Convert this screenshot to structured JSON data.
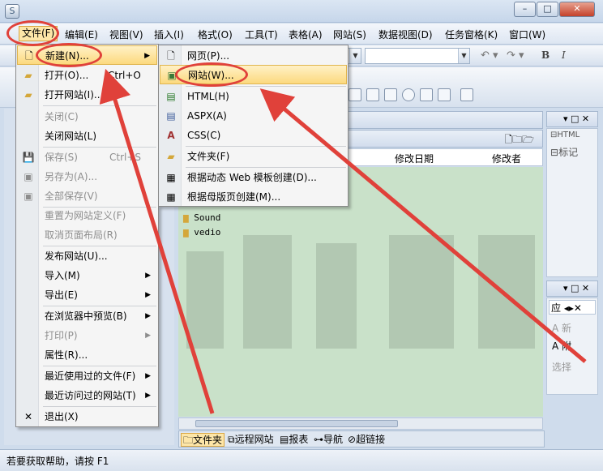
{
  "menubar": {
    "file": "文件(F)",
    "edit": "编辑(E)",
    "view": "视图(V)",
    "insert": "插入(I)",
    "format": "格式(O)",
    "tools": "工具(T)",
    "table": "表格(A)",
    "site": "网站(S)",
    "dataview": "数据视图(D)",
    "taskpane": "任务窗格(K)",
    "window": "窗口(W)"
  },
  "file_menu": {
    "new": "新建(N)...",
    "open": "打开(O)...",
    "open_shortcut": "Ctrl+O",
    "open_site": "打开网站(I)...",
    "close": "关闭(C)",
    "close_site": "关闭网站(L)",
    "save": "保存(S)",
    "save_shortcut": "Ctrl+S",
    "save_as": "另存为(A)...",
    "save_all": "全部保存(V)",
    "reset_site": "重置为网站定义(F)",
    "cancel_layout": "取消页面布局(R)",
    "publish": "发布网站(U)...",
    "import": "导入(M)",
    "export": "导出(E)",
    "preview": "在浏览器中预览(B)",
    "print": "打印(P)",
    "properties": "属性(R)...",
    "recent_files": "最近使用过的文件(F)",
    "recent_sites": "最近访问过的网站(T)",
    "exit": "退出(X)"
  },
  "new_submenu": {
    "page": "网页(P)...",
    "site": "网站(W)...",
    "html": "HTML(H)",
    "aspx": "ASPX(A)",
    "css": "CSS(C)",
    "folder": "文件夹(F)",
    "from_dynamic_template": "根据动态 Web 模板创建(D)...",
    "from_master_page": "根据母版页创建(M)..."
  },
  "filelist": {
    "col_modified": "修改日期",
    "col_modifier": "修改者",
    "rows": [
      "Sound",
      "vedio"
    ]
  },
  "right_panel": {
    "items": [
      "HTML",
      "标记",
      "应",
      "新",
      "附",
      "选择"
    ]
  },
  "bottom_tabs": {
    "folders": "文件夹",
    "remote": "远程网站",
    "reports": "报表",
    "navigation": "导航",
    "hyperlinks": "超链接"
  },
  "statusbar": {
    "text": "若要获取帮助，请按 F1"
  },
  "toolbar": {
    "bold": "B",
    "italic": "I"
  },
  "colors": {
    "highlight": "#fcd97e",
    "annotation": "#e0413a",
    "pane_bg": "#c9e1c9"
  }
}
